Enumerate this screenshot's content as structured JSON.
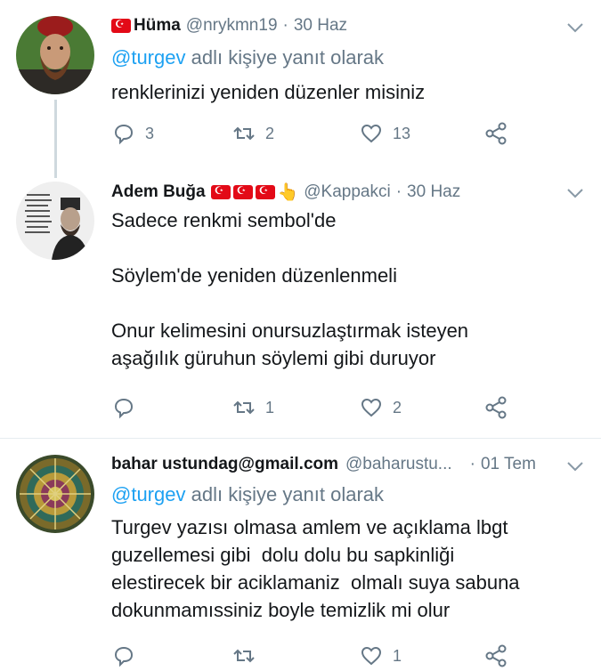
{
  "tweets": [
    {
      "display_name": "Hüma",
      "handle": "@nrykmn19",
      "dot": "·",
      "date": "30 Haz",
      "reply_link": "@turgev",
      "reply_suffix": "adlı kişiye yanıt olarak",
      "text": [
        "renklerinizi yeniden düzenler misiniz"
      ],
      "replies": "3",
      "retweets": "2",
      "likes": "13"
    },
    {
      "display_name": "Adem Buğa",
      "handle": "@Kappakci",
      "dot": "·",
      "date": "30 Haz",
      "emoji_suffix": "👆",
      "text": [
        "Sadece renkmi sembol'de",
        "",
        "Söylem'de yeniden düzenlenmeli",
        "",
        "Onur kelimesini onursuzlaştırmak isteyen",
        "aşağılık güruhun söylemi gibi duruyor"
      ],
      "replies": "",
      "retweets": "1",
      "likes": "2"
    },
    {
      "display_name": "bahar ustundag@gmail.com",
      "handle": "@baharustu...",
      "dot": "·",
      "date": "01 Tem",
      "reply_link": "@turgev",
      "reply_suffix": "adlı kişiye yanıt olarak",
      "text": [
        "Turgev yazısı olmasa amlem ve açıklama lbgt",
        "guzellemesi gibi  dolu dolu bu sapkinliği",
        "elestirecek bir aciklamaniz  olmalı suya sabuna",
        "dokunmamıssiniz boyle temizlik mi olur"
      ],
      "replies": "",
      "retweets": "",
      "likes": "1"
    }
  ],
  "colors": {
    "link": "#1da1f2",
    "muted": "#657786",
    "text": "#14171a",
    "flag": "#e30a17"
  }
}
